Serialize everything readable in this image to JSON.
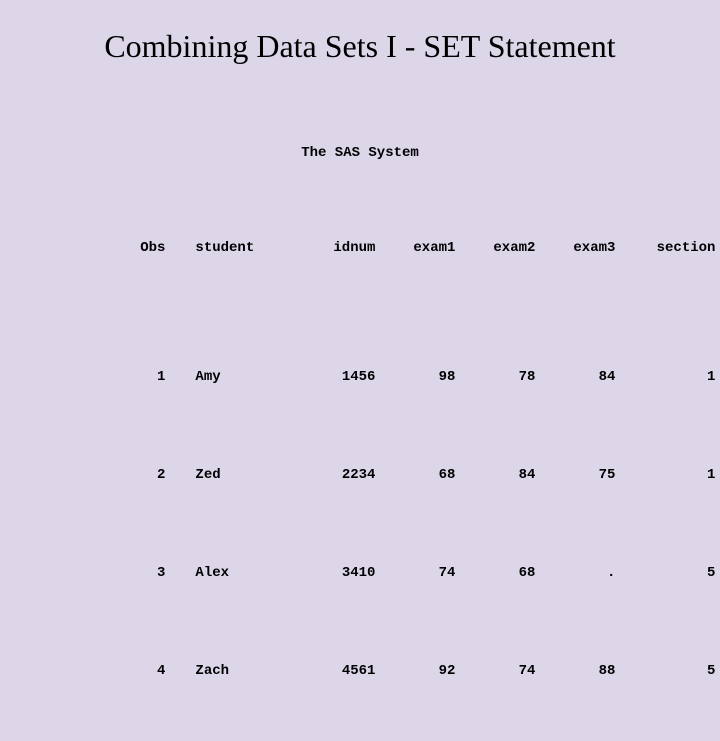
{
  "slide": {
    "title": "Combining Data Sets I - SET Statement",
    "sas_title": "The SAS System"
  },
  "table": {
    "headers": {
      "obs": "Obs",
      "student": "student",
      "idnum": "idnum",
      "exam1": "exam1",
      "exam2": "exam2",
      "exam3": "exam3",
      "section": "section"
    },
    "rows": [
      {
        "obs": "1",
        "student": "Amy",
        "idnum": "1456",
        "exam1": "98",
        "exam2": "78",
        "exam3": "84",
        "section": "1"
      },
      {
        "obs": "2",
        "student": "Zed",
        "idnum": "2234",
        "exam1": "68",
        "exam2": "84",
        "exam3": "75",
        "section": "1"
      },
      {
        "obs": "3",
        "student": "Alex",
        "idnum": "3410",
        "exam1": "74",
        "exam2": "68",
        "exam3": ".",
        "section": "5"
      },
      {
        "obs": "4",
        "student": "Zach",
        "idnum": "4561",
        "exam1": "92",
        "exam2": "74",
        "exam3": "88",
        "section": "5"
      }
    ]
  }
}
